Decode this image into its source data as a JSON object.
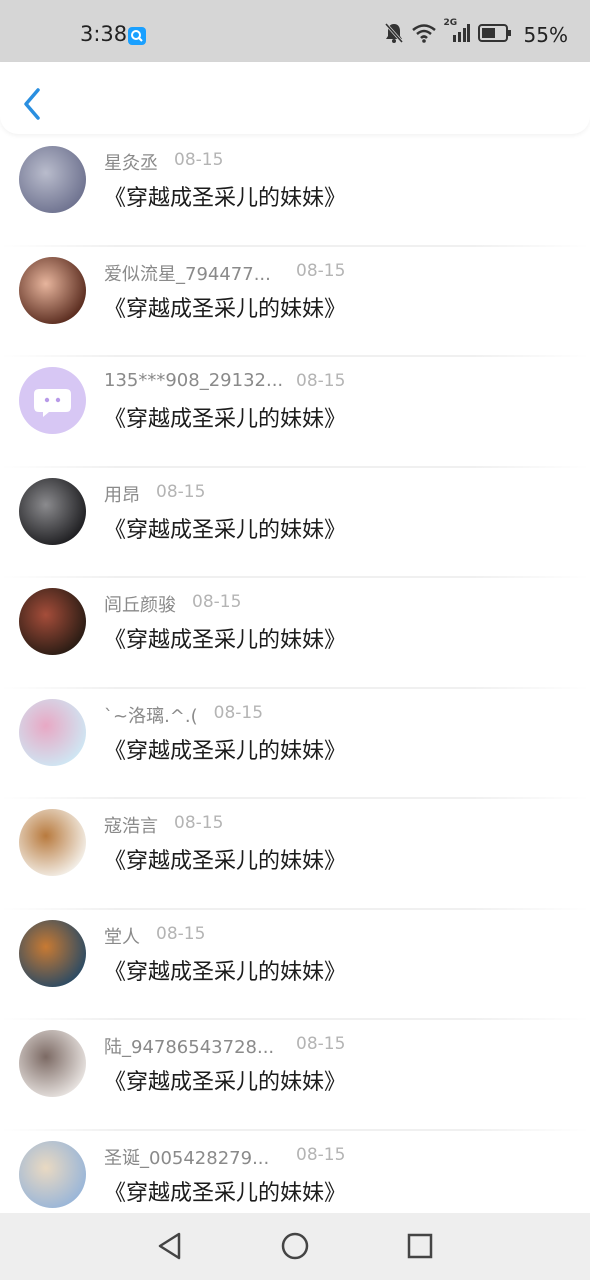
{
  "status_bar": {
    "time": "3:38",
    "battery": "55%",
    "network_label": "2G"
  },
  "header": {
    "back_icon": "chevron-left-icon",
    "accent": "#2a8fe0"
  },
  "items": [
    {
      "name": "星灸丞",
      "date": "08-15",
      "message": "《穿越成圣采儿的妹妹》",
      "avatar_colors": [
        "#6f7390",
        "#b9bccc"
      ]
    },
    {
      "name": "爱似流星_794477...",
      "date": "08-15",
      "message": "《穿越成圣采儿的妹妹》",
      "avatar_colors": [
        "#5a2c1f",
        "#e7b59d"
      ]
    },
    {
      "name": "135***908_29132...",
      "date": "08-15",
      "message": "《穿越成圣采儿的妹妹》",
      "avatar_colors": [
        "#d7c7f4",
        "#b89ae8"
      ]
    },
    {
      "name": "用昂",
      "date": "08-15",
      "message": "《穿越成圣采儿的妹妹》",
      "avatar_colors": [
        "#1f1f22",
        "#8b8b8e"
      ]
    },
    {
      "name": "闾丘颜骏",
      "date": "08-15",
      "message": "《穿越成圣采儿的妹妹》",
      "avatar_colors": [
        "#2a1c14",
        "#a54d3a"
      ]
    },
    {
      "name": "`~洛璃.^.(",
      "date": "08-15",
      "message": "《穿越成圣采儿的妹妹》",
      "avatar_colors": [
        "#cfe6f3",
        "#e8a8c4"
      ]
    },
    {
      "name": "寇浩言",
      "date": "08-15",
      "message": "《穿越成圣采儿的妹妹》",
      "avatar_colors": [
        "#f3eee6",
        "#b87a3e"
      ]
    },
    {
      "name": "堂人",
      "date": "08-15",
      "message": "《穿越成圣采儿的妹妹》",
      "avatar_colors": [
        "#2d4b63",
        "#c87a33"
      ]
    },
    {
      "name": "陆_94786543728...",
      "date": "08-15",
      "message": "《穿越成圣采儿的妹妹》",
      "avatar_colors": [
        "#e7e2df",
        "#7c6a64"
      ]
    },
    {
      "name": "圣诞_005428279...",
      "date": "08-15",
      "message": "《穿越成圣采儿的妹妹》",
      "avatar_colors": [
        "#9ab6d8",
        "#e9d9c2"
      ]
    }
  ],
  "nav_bar": {
    "back_icon": "triangle-back-icon",
    "home_icon": "circle-home-icon",
    "recents_icon": "square-recents-icon"
  }
}
